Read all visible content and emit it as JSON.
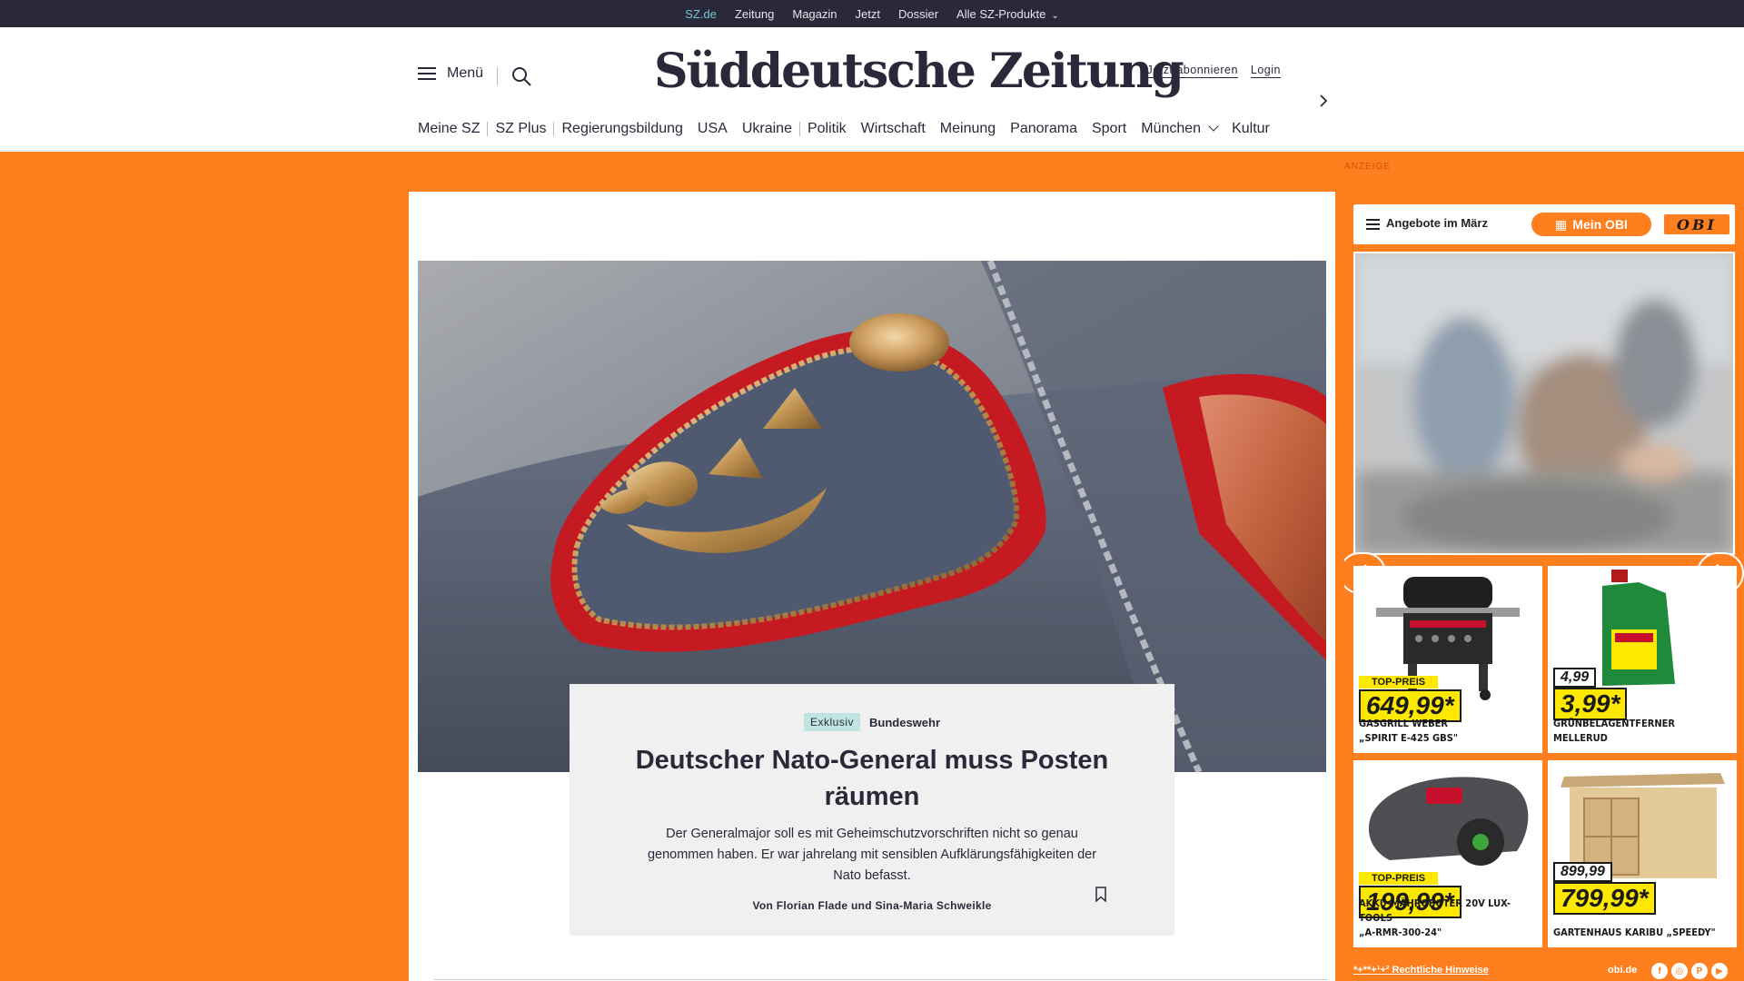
{
  "topbar": {
    "items": [
      "SZ.de",
      "Zeitung",
      "Magazin",
      "Jetzt",
      "Dossier",
      "Alle SZ-Produkte"
    ],
    "active_index": 0
  },
  "header": {
    "menu_label": "Menü",
    "logo": "Süddeutsche Zeitung",
    "subscribe_label": "Jetzt abonnieren",
    "login_label": "Login"
  },
  "nav": {
    "items": [
      "Meine SZ",
      "SZ Plus",
      "Regierungsbildung",
      "USA",
      "Ukraine",
      "Politik",
      "Wirtschaft",
      "Meinung",
      "Panorama",
      "Sport",
      "München",
      "Kultur"
    ]
  },
  "article": {
    "badge": "Exklusiv",
    "topic": "Bundeswehr",
    "headline": "Deutscher Nato-General muss Posten räumen",
    "summary": "Der Generalmajor soll es mit Geheimschutzvorschriften nicht so genau genommen haben. Er war jahrelang mit sensiblen Aufklärungsfähigkeiten der Nato befasst.",
    "author": "Von Florian Flade und Sina-Maria Schweikle"
  },
  "ad": {
    "label": "ANZEIGE",
    "offers_label": "Angebote im März",
    "mein_obi_label": "Mein OBI",
    "brand": "OBI",
    "products": [
      {
        "name_line1": "GASGRILL WEBER",
        "name_line2": "„SPIRIT E-425 GBS\"",
        "tag": "TOP-PREIS",
        "price": "649,99*",
        "old_price": ""
      },
      {
        "name_line1": "GRÜNBELAGENTFERNER",
        "name_line2": "MELLERUD",
        "tag": "",
        "price": "3,99*",
        "old_price": "4,99"
      },
      {
        "name_line1": "AKKU-MÄHROBOTER 20V LUX-TOOLS",
        "name_line2": "„A-RMR-300-24\"",
        "tag": "TOP-PREIS",
        "price": "199,99*",
        "old_price": ""
      },
      {
        "name_line1": "GARTENHAUS KARIBU „SPEEDY\"",
        "name_line2": "",
        "tag": "",
        "price": "799,99*",
        "old_price": "899,99"
      }
    ],
    "footer_legal": "*+**+¹+² Rechtliche Hinweise",
    "footer_domain": "obi.de"
  },
  "colors": {
    "sz_navy": "#29293a",
    "obi_orange": "#ff7f1f",
    "badge_teal": "#bfe4e2",
    "price_yellow": "#ffe800"
  }
}
